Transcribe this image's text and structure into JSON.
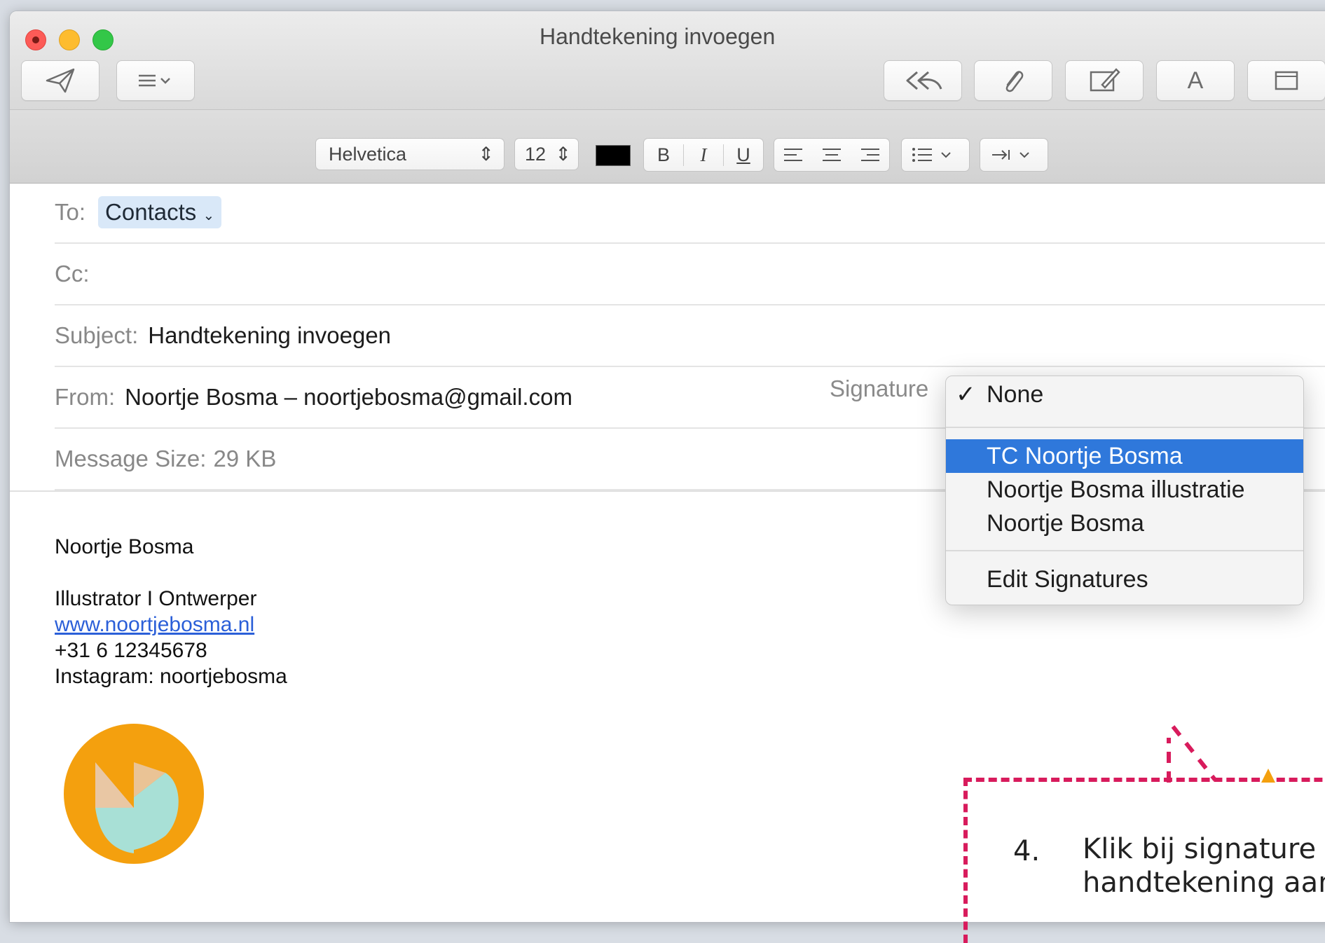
{
  "window": {
    "title": "Handtekening invoegen"
  },
  "format_bar": {
    "font": "Helvetica",
    "size": "12",
    "bold": "B",
    "italic": "I",
    "underline": "U",
    "text_color": "#000000"
  },
  "toolbar": {
    "font_letter": "A"
  },
  "header": {
    "to_label": "To:",
    "to_value": "Contacts",
    "cc_label": "Cc:",
    "subject_label": "Subject:",
    "subject_value": "Handtekening invoegen",
    "from_label": "From:",
    "from_value": "Noortje Bosma – noortjebosma@gmail.com",
    "size_label": "Message Size:",
    "size_value": "29 KB",
    "signature_label": "Signature"
  },
  "signature_menu": {
    "items": [
      "None",
      "TC Noortje Bosma",
      "Noortje Bosma illustratie",
      "Noortje Bosma",
      "Edit Signatures"
    ],
    "checked": "None",
    "selected": "TC Noortje Bosma",
    "highlight_color": "#2f78db"
  },
  "body": {
    "name": "Noortje Bosma",
    "role": "Illustrator I Ontwerper",
    "website": "www.noortjebosma.nl",
    "phone": "+31 6 12345678",
    "instagram": "Instagram: noortjebosma"
  },
  "callout": {
    "number": "4.",
    "text": "Klik bij signature o\nhandtekening aan",
    "color": "#d81b5c"
  }
}
